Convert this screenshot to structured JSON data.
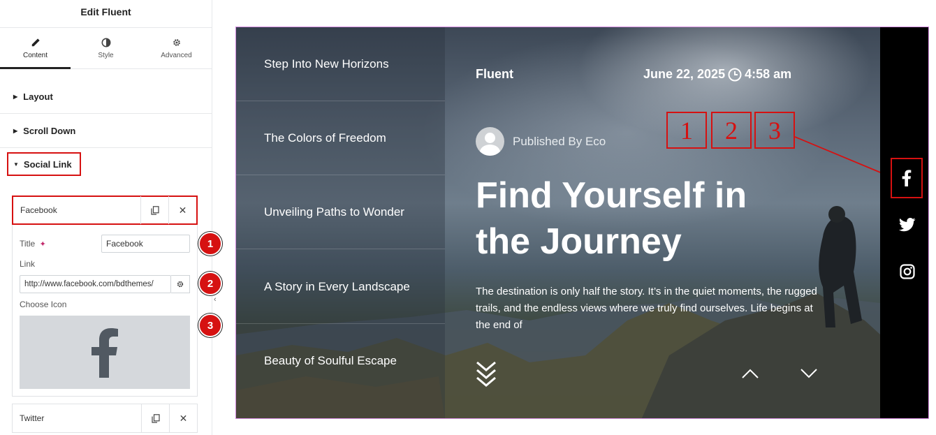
{
  "editor": {
    "title": "Edit Fluent",
    "tabs": [
      {
        "label": "Content",
        "icon": "pencil-icon"
      },
      {
        "label": "Style",
        "icon": "contrast-icon"
      },
      {
        "label": "Advanced",
        "icon": "gear-icon"
      }
    ],
    "sections": {
      "layout": "Layout",
      "scroll_down": "Scroll Down",
      "social_link": "Social Link"
    },
    "items": [
      {
        "label": "Facebook"
      },
      {
        "label": "Twitter"
      }
    ],
    "fields": {
      "title_label": "Title",
      "title_value": "Facebook",
      "link_label": "Link",
      "link_value": "http://www.facebook.com/bdthemes/",
      "icon_label": "Choose Icon"
    },
    "badges": [
      "1",
      "2",
      "3"
    ]
  },
  "preview": {
    "menu": [
      "Step Into New Horizons",
      "The Colors of Freedom",
      "Unveiling Paths to Wonder",
      "A Story in Every Landscape",
      "Beauty of Soulful Escape"
    ],
    "brand": "Fluent",
    "date": "June 22, 2025",
    "time": "4:58 am",
    "author": "Published By Eco",
    "headline": "Find Yourself in the Journey",
    "description": "The destination is only half the story. It’s in the quiet moments, the rugged trails, and the endless views where we truly find ourselves. Life begins at the end of",
    "callouts": [
      "1",
      "2",
      "3"
    ],
    "social_icons": [
      "facebook-icon",
      "twitter-icon",
      "instagram-icon"
    ]
  },
  "colors": {
    "accent_red": "#d61111",
    "social_bar": "#000000",
    "preview_border": "#d58be0"
  }
}
